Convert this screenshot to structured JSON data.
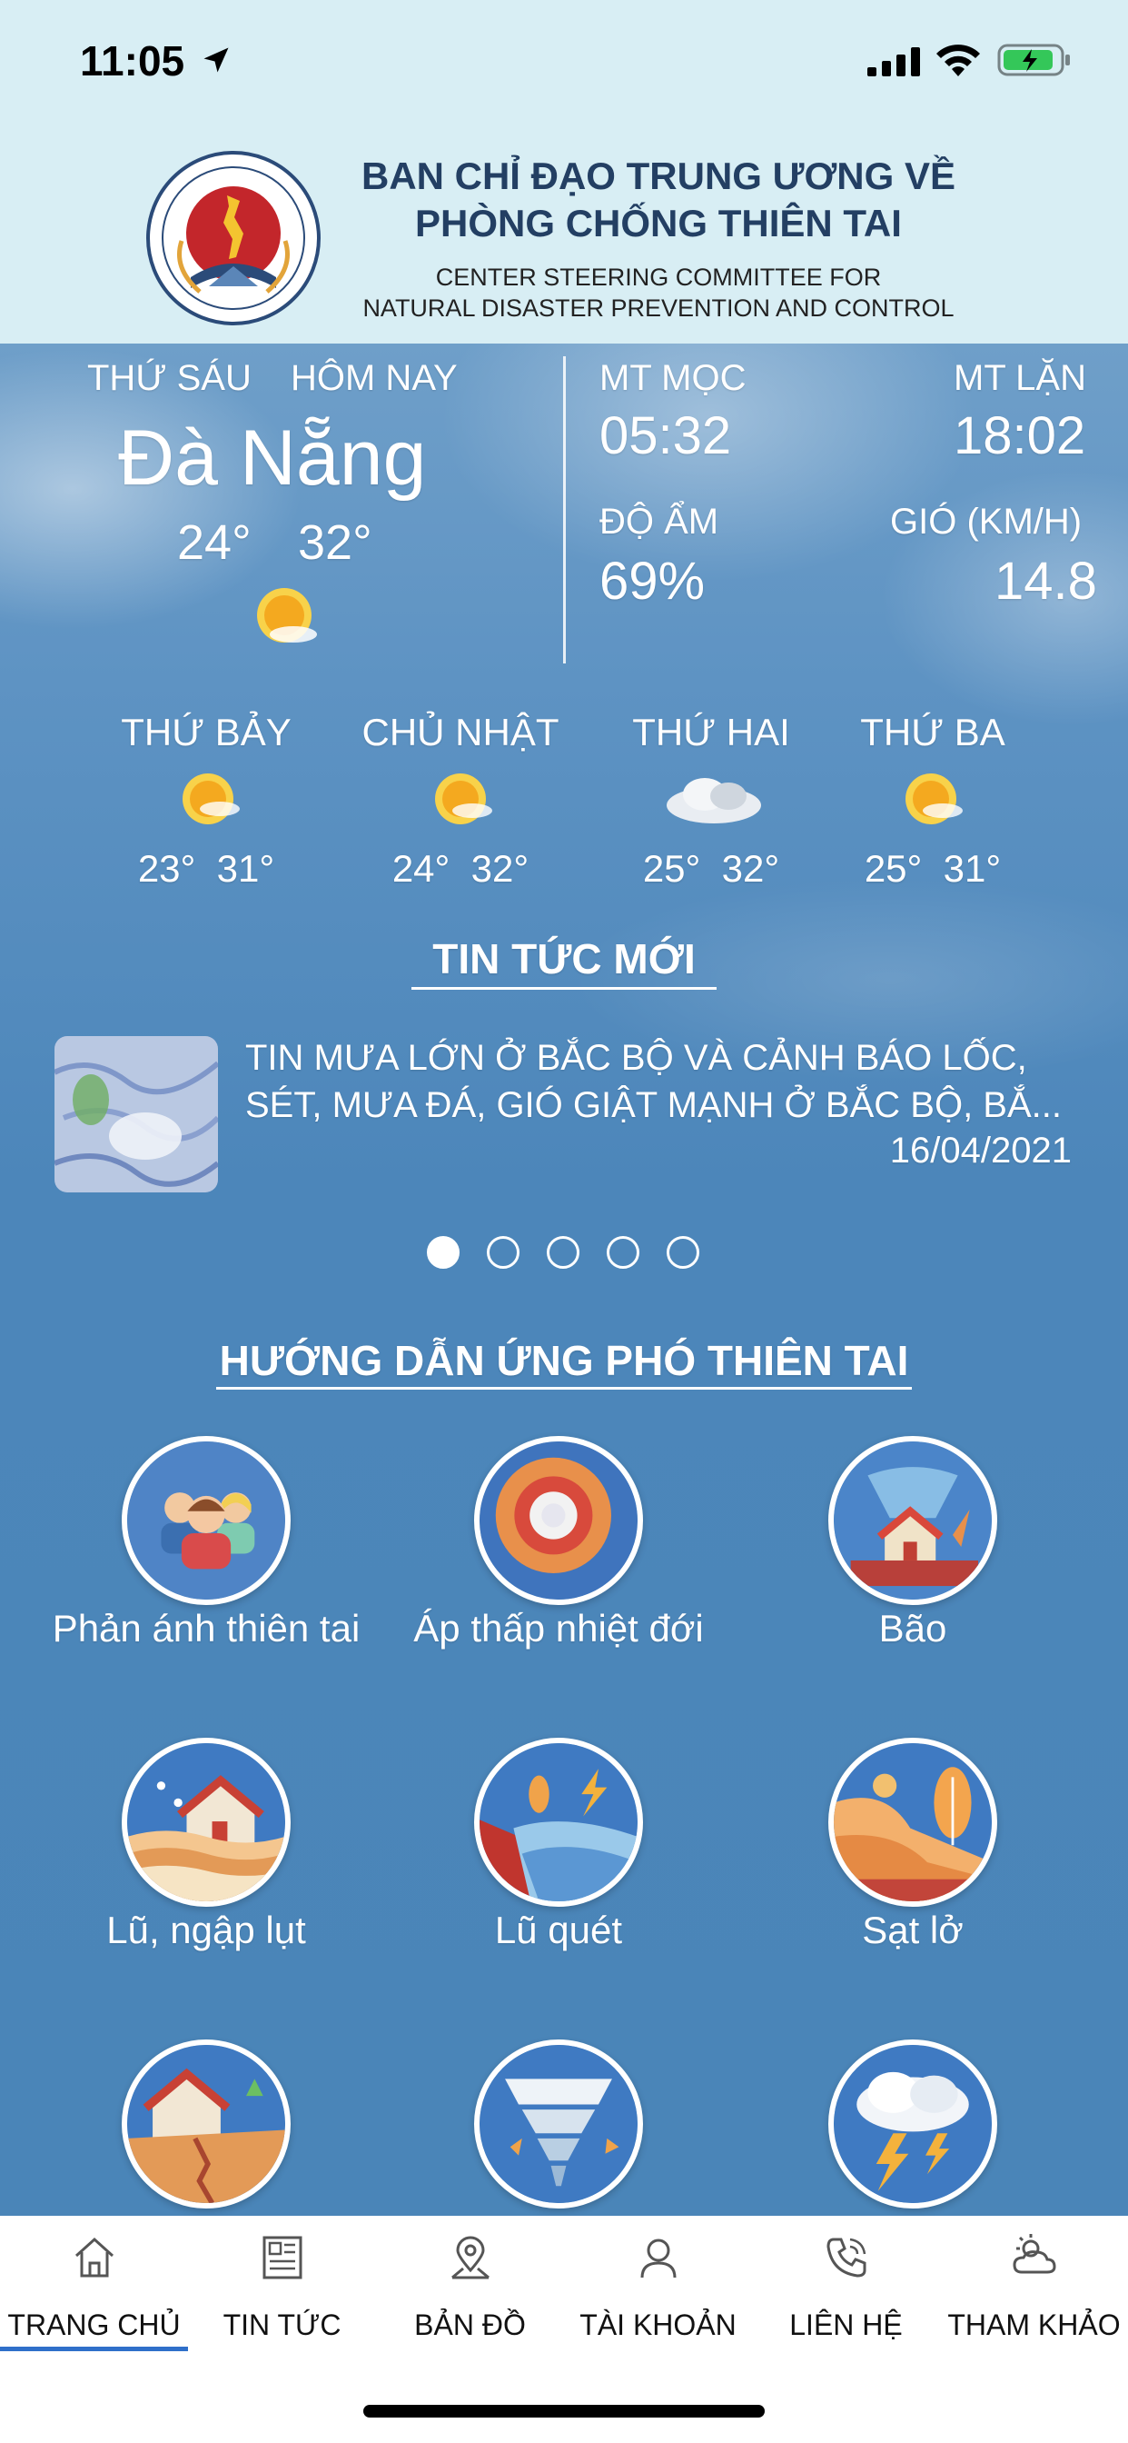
{
  "status_bar": {
    "time": "11:05"
  },
  "header": {
    "title_vi_line1": "BAN CHỈ ĐẠO TRUNG ƯƠNG VỀ",
    "title_vi_line2": "PHÒNG CHỐNG THIÊN TAI",
    "title_en_line1": "CENTER STEERING COMMITTEE FOR",
    "title_en_line2": "NATURAL DISASTER PREVENTION AND CONTROL"
  },
  "today": {
    "day": "THỨ SÁU",
    "label": "HÔM NAY",
    "city": "Đà Nẵng",
    "temp_low": "24°",
    "temp_high": "32°",
    "weather_icon": "sunny-icon"
  },
  "details": {
    "sunrise_label": "MT MỌC",
    "sunrise": "05:32",
    "sunset_label": "MT LẶN",
    "sunset": "18:02",
    "humidity_label": "ĐỘ ẨM",
    "humidity": "69%",
    "wind_label": "GIÓ (KM/H)",
    "wind": "14.8"
  },
  "forecast": [
    {
      "day": "THỨ BẢY",
      "low": "23°",
      "high": "31°",
      "icon": "sunny-icon"
    },
    {
      "day": "CHỦ NHẬT",
      "low": "24°",
      "high": "32°",
      "icon": "sunny-icon"
    },
    {
      "day": "THỨ HAI",
      "low": "25°",
      "high": "32°",
      "icon": "cloudy-icon"
    },
    {
      "day": "THỨ BA",
      "low": "25°",
      "high": "31°",
      "icon": "sunny-icon"
    }
  ],
  "news": {
    "section_title": "TIN TỨC MỚI",
    "headline_line1": "TIN MƯA LỚN Ở BẮC BỘ VÀ CẢNH BÁO LỐC,",
    "headline_line2": "SÉT, MƯA ĐÁ, GIÓ GIẬT MẠNH Ở BẮC BỘ, BẮ...",
    "date": "16/04/2021",
    "pager_count": 5,
    "pager_active": 1
  },
  "guide": {
    "section_title": "HƯỚNG DẪN ỨNG PHÓ THIÊN TAI",
    "items": [
      {
        "label": "Phản ánh thiên tai",
        "icon": "people-report-icon"
      },
      {
        "label": "Áp thấp nhiệt đới",
        "icon": "target-depression-icon"
      },
      {
        "label": "Bão",
        "icon": "storm-house-icon"
      },
      {
        "label": "Lũ, ngập lụt",
        "icon": "flood-house-icon"
      },
      {
        "label": "Lũ quét",
        "icon": "flash-flood-icon"
      },
      {
        "label": "Sạt lở",
        "icon": "landslide-icon"
      },
      {
        "label": "",
        "icon": "earthquake-icon"
      },
      {
        "label": "",
        "icon": "tornado-icon"
      },
      {
        "label": "",
        "icon": "thunderstorm-icon"
      }
    ]
  },
  "nav": {
    "items": [
      {
        "label": "TRANG CHỦ",
        "icon": "home-icon",
        "active": true
      },
      {
        "label": "TIN TỨC",
        "icon": "newspaper-icon"
      },
      {
        "label": "BẢN ĐỒ",
        "icon": "map-pin-icon"
      },
      {
        "label": "TÀI KHOẢN",
        "icon": "user-icon"
      },
      {
        "label": "LIÊN HỆ",
        "icon": "phone-icon"
      },
      {
        "label": "THAM KHẢO",
        "icon": "weather-cloud-icon"
      }
    ]
  },
  "colors": {
    "header_bg": "#d8eef4",
    "header_text": "#233f63",
    "sky": "#4a85b8",
    "nav_active": "#2f6fc9"
  }
}
